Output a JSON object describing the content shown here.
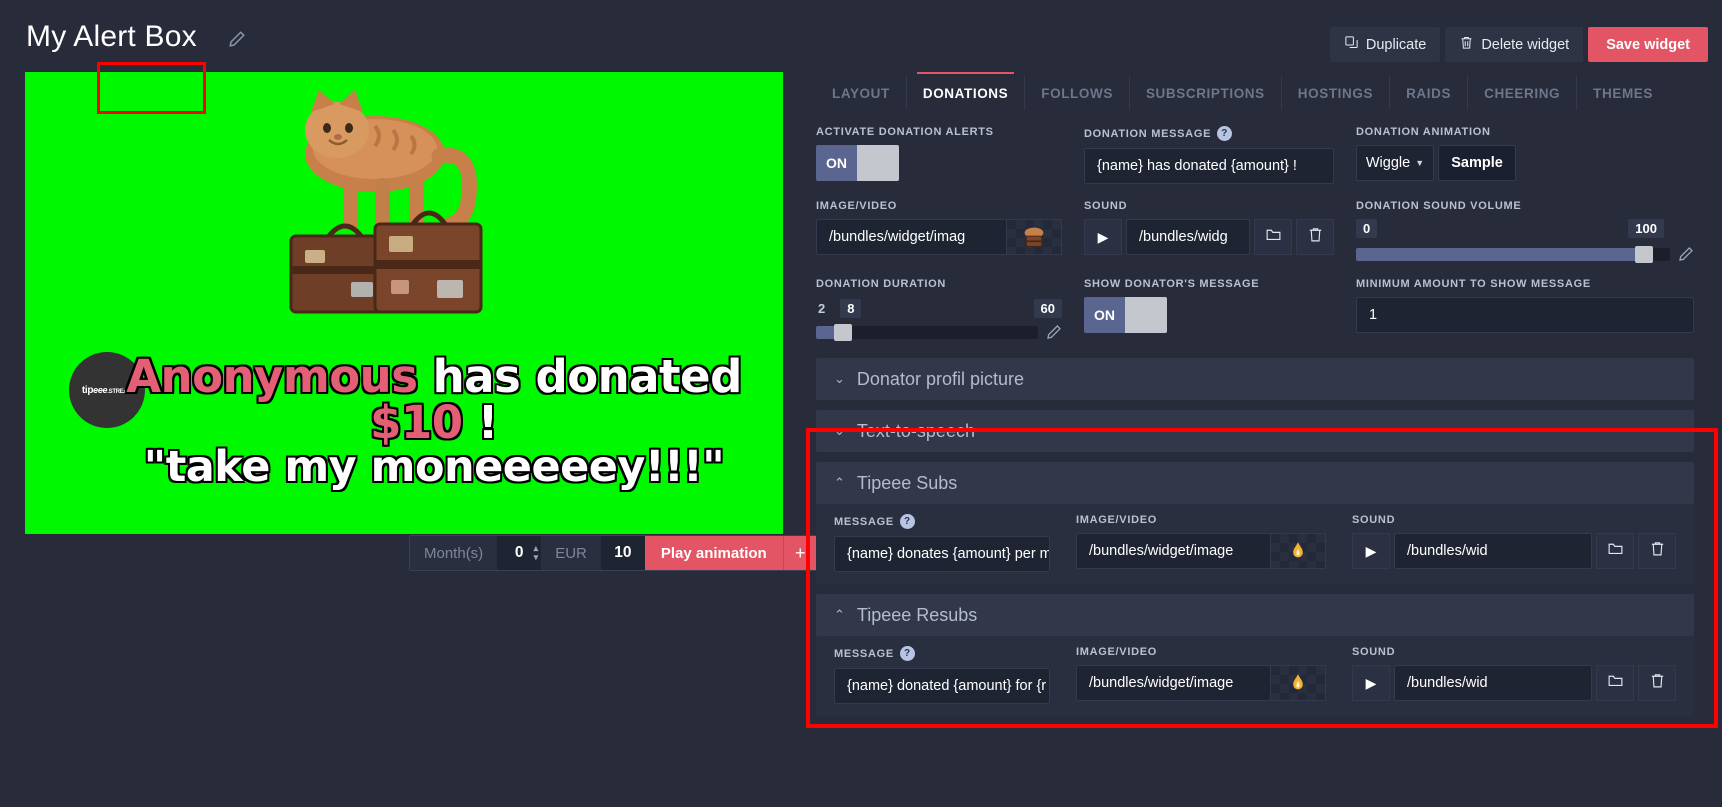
{
  "header": {
    "title": "My Alert Box",
    "edit_icon": "pencil-icon",
    "buttons": {
      "duplicate": "Duplicate",
      "delete": "Delete widget",
      "save": "Save widget"
    }
  },
  "preview": {
    "logo_text": "tip",
    "logo_text_italic": "eee",
    "logo_text_small": ".STREAM",
    "alert": {
      "donor": "Anonymous",
      "line1_mid": " has donated ",
      "amount": "$10",
      "line1_end": " !",
      "line2": "\"take my moneeeeey!!!\""
    },
    "controls": {
      "months_label": "Month(s)",
      "months_value": "0",
      "currency_label": "EUR",
      "amount_value": "10",
      "play_label": "Play animation",
      "plus_label": "+"
    }
  },
  "tabs": [
    {
      "label": "LAYOUT",
      "active": false
    },
    {
      "label": "DONATIONS",
      "active": true
    },
    {
      "label": "FOLLOWS",
      "active": false
    },
    {
      "label": "SUBSCRIPTIONS",
      "active": false
    },
    {
      "label": "HOSTINGS",
      "active": false
    },
    {
      "label": "RAIDS",
      "active": false
    },
    {
      "label": "CHEERING",
      "active": false
    },
    {
      "label": "THEMES",
      "active": false
    }
  ],
  "donations": {
    "activate_label": "ACTIVATE DONATION ALERTS",
    "activate_value": "ON",
    "message_label": "DONATION MESSAGE",
    "message_value": "{name} has donated {amount} !",
    "animation_label": "DONATION ANIMATION",
    "animation_value": "Wiggle",
    "animation_sample": "Sample",
    "imagevideo_label": "IMAGE/VIDEO",
    "imagevideo_value": "/bundles/widget/imag",
    "sound_label": "SOUND",
    "sound_value": "/bundles/widg",
    "volume_label": "DONATION SOUND VOLUME",
    "volume_min": "0",
    "volume_max": "100",
    "duration_label": "DONATION DURATION",
    "duration_min": "2",
    "duration_value": "8",
    "duration_max": "60",
    "show_donator_label": "SHOW DONATOR'S MESSAGE",
    "show_donator_value": "ON",
    "min_amount_label": "MINIMUM AMOUNT TO SHOW MESSAGE",
    "min_amount_value": "1"
  },
  "accordions": [
    {
      "title": "Donator profil picture",
      "state": "collapsed",
      "chevron": "chevron-down-icon"
    },
    {
      "title": "Text-to-speech",
      "state": "collapsed",
      "chevron": "chevron-down-icon"
    }
  ],
  "tipeee_subs": {
    "title": "Tipeee Subs",
    "chevron": "chevron-up-icon",
    "message_label": "MESSAGE",
    "message_value": "{name} donates {amount} per m",
    "imagevideo_label": "IMAGE/VIDEO",
    "imagevideo_value": "/bundles/widget/image",
    "sound_label": "SOUND",
    "sound_value": "/bundles/wid"
  },
  "tipeee_resubs": {
    "title": "Tipeee Resubs",
    "chevron": "chevron-up-icon",
    "message_label": "MESSAGE",
    "message_value": "{name} donated {amount} for {r",
    "imagevideo_label": "IMAGE/VIDEO",
    "imagevideo_value": "/bundles/widget/image",
    "sound_label": "SOUND",
    "sound_value": "/bundles/wid"
  },
  "colors": {
    "accent_red": "#e35464",
    "annotation_red": "#ff0000",
    "panel_bg": "#272b3a",
    "input_bg": "#1f2433",
    "toggle_on": "#5a6590",
    "chroma_green": "#00f900"
  }
}
